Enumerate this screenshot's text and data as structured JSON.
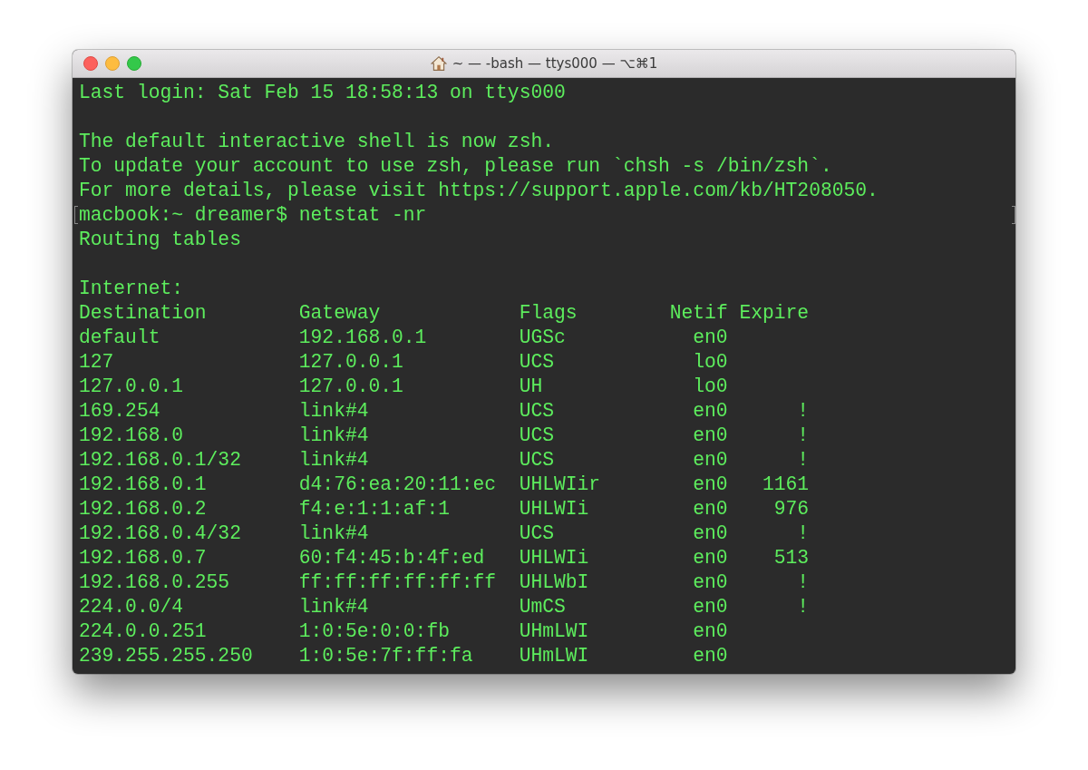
{
  "window": {
    "title": "~ — -bash — ttys000 — ⌥⌘1"
  },
  "terminal": {
    "login_message": "Last login: Sat Feb 15 18:58:13 on ttys000",
    "notice_lines": [
      "The default interactive shell is now zsh.",
      "To update your account to use zsh, please run `chsh -s /bin/zsh`.",
      "For more details, please visit https://support.apple.com/kb/HT208050."
    ],
    "prompt": "macbook:~ dreamer$",
    "command": "netstat -nr",
    "output_title": "Routing tables",
    "section": "Internet:",
    "table": {
      "columns": [
        "Destination",
        "Gateway",
        "Flags",
        "Netif",
        "Expire"
      ],
      "rows": [
        {
          "destination": "default",
          "gateway": "192.168.0.1",
          "flags": "UGSc",
          "netif": "en0"
        },
        {
          "destination": "127",
          "gateway": "127.0.0.1",
          "flags": "UCS",
          "netif": "lo0"
        },
        {
          "destination": "127.0.0.1",
          "gateway": "127.0.0.1",
          "flags": "UH",
          "netif": "lo0"
        },
        {
          "destination": "169.254",
          "gateway": "link#4",
          "flags": "UCS",
          "netif": "en0",
          "expire": "!"
        },
        {
          "destination": "192.168.0",
          "gateway": "link#4",
          "flags": "UCS",
          "netif": "en0",
          "expire": "!"
        },
        {
          "destination": "192.168.0.1/32",
          "gateway": "link#4",
          "flags": "UCS",
          "netif": "en0",
          "expire": "!"
        },
        {
          "destination": "192.168.0.1",
          "gateway": "d4:76:ea:20:11:ec",
          "flags": "UHLWIir",
          "netif": "en0",
          "expire": "1161"
        },
        {
          "destination": "192.168.0.2",
          "gateway": "f4:e:1:1:af:1",
          "flags": "UHLWIi",
          "netif": "en0",
          "expire": "976"
        },
        {
          "destination": "192.168.0.4/32",
          "gateway": "link#4",
          "flags": "UCS",
          "netif": "en0",
          "expire": "!"
        },
        {
          "destination": "192.168.0.7",
          "gateway": "60:f4:45:b:4f:ed",
          "flags": "UHLWIi",
          "netif": "en0",
          "expire": "513"
        },
        {
          "destination": "192.168.0.255",
          "gateway": "ff:ff:ff:ff:ff:ff",
          "flags": "UHLWbI",
          "netif": "en0",
          "expire": "!"
        },
        {
          "destination": "224.0.0/4",
          "gateway": "link#4",
          "flags": "UmCS",
          "netif": "en0",
          "expire": "!"
        },
        {
          "destination": "224.0.0.251",
          "gateway": "1:0:5e:0:0:fb",
          "flags": "UHmLWI",
          "netif": "en0"
        },
        {
          "destination": "239.255.255.250",
          "gateway": "1:0:5e:7f:ff:fa",
          "flags": "UHmLWI",
          "netif": "en0"
        }
      ]
    }
  }
}
